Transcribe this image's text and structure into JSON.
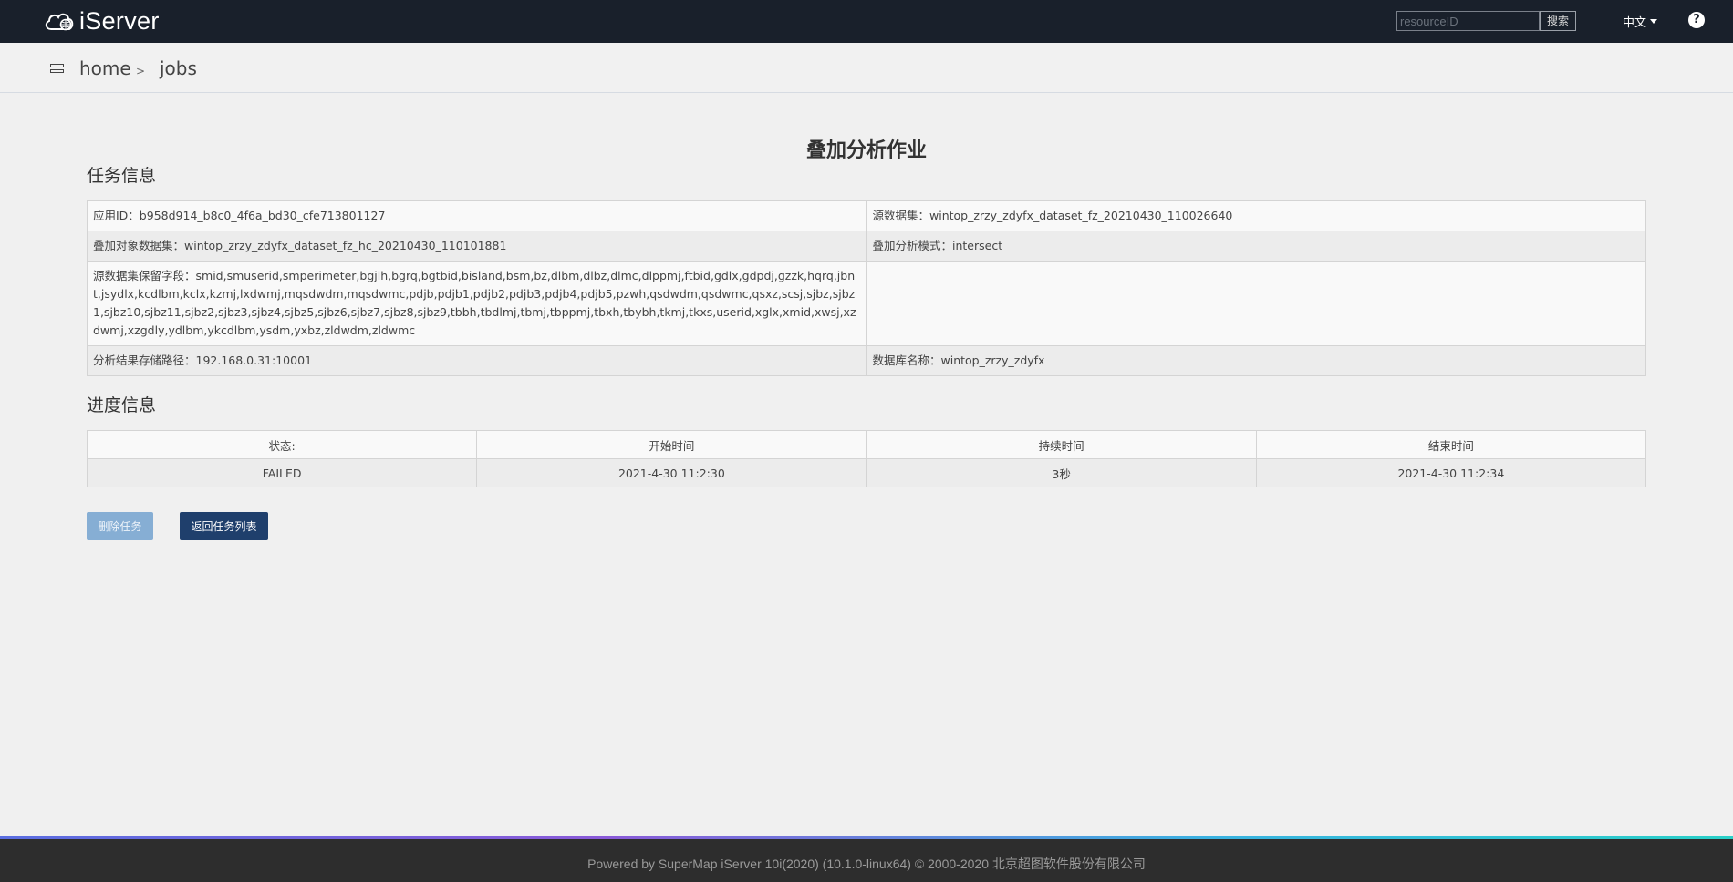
{
  "header": {
    "logo_text": "iServer",
    "search_placeholder": "resourceID",
    "search_button": "搜索",
    "language": "中文",
    "help": "?"
  },
  "breadcrumb": {
    "home": "home",
    "separator": ">",
    "current": "jobs"
  },
  "page_title": "叠加分析作业",
  "task_section": {
    "heading": "任务信息",
    "rows": [
      [
        "应用ID：b958d914_b8c0_4f6a_bd30_cfe713801127",
        "源数据集：wintop_zrzy_zdyfx_dataset_fz_20210430_110026640"
      ],
      [
        "叠加对象数据集：wintop_zrzy_zdyfx_dataset_fz_hc_20210430_110101881",
        "叠加分析模式：intersect"
      ],
      [
        "源数据集保留字段：smid,smuserid,smperimeter,bgjlh,bgrq,bgtbid,bisland,bsm,bz,dlbm,dlbz,dlmc,dlppmj,ftbid,gdlx,gdpdj,gzzk,hqrq,jbnt,jsydlx,kcdlbm,kclx,kzmj,lxdwmj,mqsdwdm,mqsdwmc,pdjb,pdjb1,pdjb2,pdjb3,pdjb4,pdjb5,pzwh,qsdwdm,qsdwmc,qsxz,scsj,sjbz,sjbz1,sjbz10,sjbz11,sjbz2,sjbz3,sjbz4,sjbz5,sjbz6,sjbz7,sjbz8,sjbz9,tbbh,tbdlmj,tbmj,tbppmj,tbxh,tbybh,tkmj,tkxs,userid,xglx,xmid,xwsj,xzdwmj,xzgdly,ydlbm,ykcdlbm,ysdm,yxbz,zldwdm,zldwmc",
        ""
      ],
      [
        "分析结果存储路径：192.168.0.31:10001",
        "数据库名称：wintop_zrzy_zdyfx"
      ]
    ]
  },
  "progress_section": {
    "heading": "进度信息",
    "headers": [
      "状态:",
      "开始时间",
      "持续时间",
      "结束时间"
    ],
    "values": [
      "FAILED",
      "2021-4-30 11:2:30",
      "3秒",
      "2021-4-30 11:2:34"
    ]
  },
  "buttons": {
    "delete": "删除任务",
    "back": "返回任务列表"
  },
  "footer": {
    "text": "Powered by SuperMap iServer 10i(2020) (10.1.0-linux64) © 2000-2020 北京超图软件股份有限公司"
  }
}
